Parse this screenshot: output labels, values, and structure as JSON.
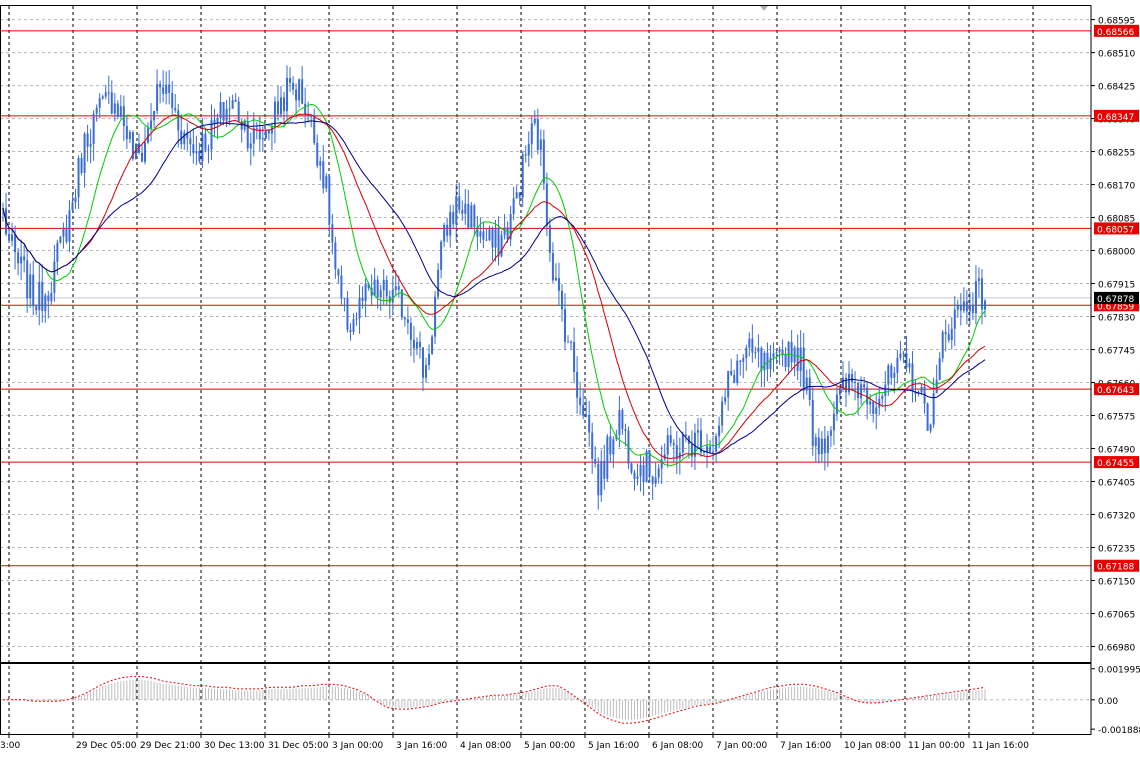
{
  "chart_data": {
    "type": "candlestick",
    "main": {
      "y_range": [
        0.6694,
        0.6863
      ],
      "y_ticks": [
        "0.68595",
        "0.68510",
        "0.68425",
        "0.68340",
        "0.68255",
        "0.68170",
        "0.68085",
        "0.68000",
        "0.67915",
        "0.67830",
        "0.67745",
        "0.67660",
        "0.67575",
        "0.67490",
        "0.67405",
        "0.67320",
        "0.67235",
        "0.67150",
        "0.67065",
        "0.66980"
      ],
      "current_price": "0.67878",
      "levels": [
        {
          "label": "0.68566",
          "value": 0.68566
        },
        {
          "label": "0.68347",
          "value": 0.68347
        },
        {
          "label": "0.68057",
          "value": 0.68057
        },
        {
          "label": "0.67859",
          "value": 0.67859
        },
        {
          "label": "0.67643",
          "value": 0.67643
        },
        {
          "label": "0.67455",
          "value": 0.67455
        },
        {
          "label": "0.67188",
          "value": 0.67188
        }
      ],
      "anchor_closes": [
        0.681,
        0.6801,
        0.6797,
        0.6794,
        0.6789,
        0.6787,
        0.6789,
        0.6793,
        0.6799,
        0.6805,
        0.6812,
        0.6821,
        0.6829,
        0.6833,
        0.6836,
        0.6838,
        0.684,
        0.6836,
        0.683,
        0.6824,
        0.6825,
        0.6831,
        0.6839,
        0.6842,
        0.684,
        0.6835,
        0.683,
        0.6828,
        0.6826,
        0.6828,
        0.683,
        0.6833,
        0.6836,
        0.6838,
        0.6836,
        0.6832,
        0.6829,
        0.6829,
        0.6831,
        0.6834,
        0.6838,
        0.6841,
        0.6842,
        0.6841,
        0.6836,
        0.6829,
        0.6823,
        0.6812,
        0.6795,
        0.6785,
        0.6781,
        0.6783,
        0.6787,
        0.6788,
        0.6789,
        0.6789,
        0.6788,
        0.6787,
        0.6785,
        0.6781,
        0.6774,
        0.6768,
        0.678,
        0.6795,
        0.6805,
        0.681,
        0.6812,
        0.681,
        0.6808,
        0.6804,
        0.6802,
        0.6801,
        0.6803,
        0.6806,
        0.6812,
        0.682,
        0.6828,
        0.6832,
        0.6823,
        0.6803,
        0.679,
        0.6783,
        0.6775,
        0.6765,
        0.676,
        0.675,
        0.674,
        0.6745,
        0.6752,
        0.6758,
        0.6752,
        0.6746,
        0.6745,
        0.6744,
        0.6743,
        0.6746,
        0.6748,
        0.6749,
        0.675,
        0.675,
        0.6751,
        0.6752,
        0.6751,
        0.675,
        0.6758,
        0.6767,
        0.677,
        0.6772,
        0.6773,
        0.6772,
        0.677,
        0.6769,
        0.677,
        0.6774,
        0.6775,
        0.6773,
        0.6767,
        0.6754,
        0.6751,
        0.6752,
        0.6758,
        0.6762,
        0.6765,
        0.6766,
        0.6765,
        0.6764,
        0.6762,
        0.6764,
        0.6766,
        0.6768,
        0.677,
        0.6769,
        0.6766,
        0.676,
        0.6757,
        0.6764,
        0.6778,
        0.6782,
        0.6784,
        0.6786,
        0.6788,
        0.6789,
        0.6788
      ]
    },
    "oscillator": {
      "y_range": [
        -0.0022,
        0.0023
      ],
      "y_ticks": [
        "0.001995",
        "0.00",
        "-0.001888"
      ],
      "anchors": [
        0.0,
        0.0,
        0.0,
        -0.0001,
        -0.0001,
        -0.0001,
        0.0,
        0.0002,
        0.0005,
        0.0009,
        0.0012,
        0.0014,
        0.0015,
        0.0015,
        0.0014,
        0.0012,
        0.0011,
        0.001,
        0.0009,
        0.0009,
        0.0008,
        0.0008,
        0.0007,
        0.0007,
        0.0007,
        0.0008,
        0.0008,
        0.0008,
        0.0009,
        0.0009,
        0.001,
        0.001,
        0.0009,
        0.0007,
        0.0004,
        -0.0001,
        -0.0005,
        -0.0006,
        -0.0006,
        -0.0005,
        -0.0004,
        -0.0002,
        -0.0001,
        0.0,
        0.0001,
        0.0002,
        0.0003,
        0.0003,
        0.0004,
        0.0005,
        0.0007,
        0.0009,
        0.0009,
        0.0005,
        0.0,
        -0.0005,
        -0.001,
        -0.0013,
        -0.0015,
        -0.0015,
        -0.0014,
        -0.0012,
        -0.001,
        -0.0008,
        -0.0006,
        -0.0004,
        -0.0003,
        -0.0002,
        0.0,
        0.0002,
        0.0004,
        0.0006,
        0.0008,
        0.0009,
        0.001,
        0.001,
        0.0009,
        0.0007,
        0.0005,
        0.0002,
        -0.0001,
        -0.0002,
        -0.0002,
        -0.0001,
        0.0,
        0.0001,
        0.0002,
        0.0003,
        0.0004,
        0.0005,
        0.0006,
        0.0007,
        0.0008
      ]
    },
    "x_labels": [
      "3:00",
      "29 Dec 05:00",
      "29 Dec 21:00",
      "30 Dec 13:00",
      "31 Dec 05:00",
      "3 Jan 00:00",
      "3 Jan 16:00",
      "4 Jan 08:00",
      "5 Jan 00:00",
      "5 Jan 16:00",
      "6 Jan 08:00",
      "7 Jan 00:00",
      "7 Jan 16:00",
      "10 Jan 08:00",
      "11 Jan 00:00",
      "11 Jan 16:00"
    ],
    "moving_averages": [
      {
        "color": "#00cc00",
        "period": 5
      },
      {
        "color": "#d40000",
        "period": 9
      },
      {
        "color": "#000090",
        "period": 14
      }
    ],
    "colors": {
      "candle": "#3a6cd4",
      "level": "#e80000",
      "grid": "#b8b8b8",
      "osc_bar": "#bdbdbd",
      "osc_signal": "#e60000",
      "price_tag": "#000000"
    }
  }
}
